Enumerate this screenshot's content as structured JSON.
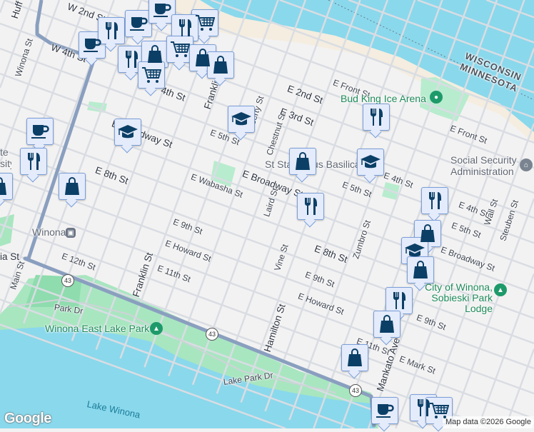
{
  "streets": [
    "W 2nd St",
    "Huff",
    "W 4th St",
    "Winona St",
    "4th St",
    "Franklin",
    "E Broadway St",
    "E 8th St",
    "E Wabasha St",
    "Liberty St",
    "E 5th St",
    "Chestnut St",
    "E 2nd St",
    "E 3rd St",
    "E Front St",
    "E Front St",
    "E 4th St",
    "E 5th St",
    "E Broadway St",
    "Laird St",
    "E 4th St",
    "E 5th St",
    "Wall St",
    "Steuben St",
    "E Broadway St",
    "E 9th St",
    "E Howard St",
    "E 12th St",
    "E 11th St",
    "Franklin St",
    "Main St",
    "Vine St",
    "E 8th St",
    "Zumbro St",
    "E 9th St",
    "E Howard St",
    "Hamilton St",
    "E 11th St",
    "E Mark St",
    "Mankato Ave",
    "E 9th St",
    "Park Dr",
    "Lake Park Dr",
    "Main St",
    "ia St"
  ],
  "places": {
    "bud_king": "Bud King Ice Arena",
    "ssa": "Social Security Administration",
    "basilica": "St Stanislaus Basilica",
    "winona_station": "Winona",
    "east_lake_park": "Winona East Lake Park",
    "sobieski": "City of Winona, Sobieski Park Lodge",
    "lake": "Lake Winona",
    "wisconsin": "WISCONSIN",
    "minnesota": "MINNESOTA",
    "state_university": "te sity"
  },
  "highway": "43",
  "markers": [
    "coffee",
    "restaurant",
    "shopping",
    "shopping",
    "school",
    "school",
    "coffee",
    "restaurant",
    "coffee",
    "restaurant",
    "coffee",
    "grocery",
    "restaurant",
    "shopping",
    "grocery",
    "shopping",
    "shopping",
    "grocery",
    "shopping",
    "school",
    "restaurant",
    "restaurant",
    "restaurant",
    "shopping",
    "school",
    "shopping",
    "restaurant",
    "shopping",
    "shopping",
    "coffee",
    "restaurant",
    "grocery"
  ],
  "footer": {
    "logo": "Google",
    "attribution": "Map data ©2026 Google"
  },
  "colors": {
    "water": "#8ad8ec",
    "park": "#a8e6c0",
    "land": "#f3f2f2",
    "highway": "#8a9fbf",
    "marker": "#0b3f66"
  }
}
